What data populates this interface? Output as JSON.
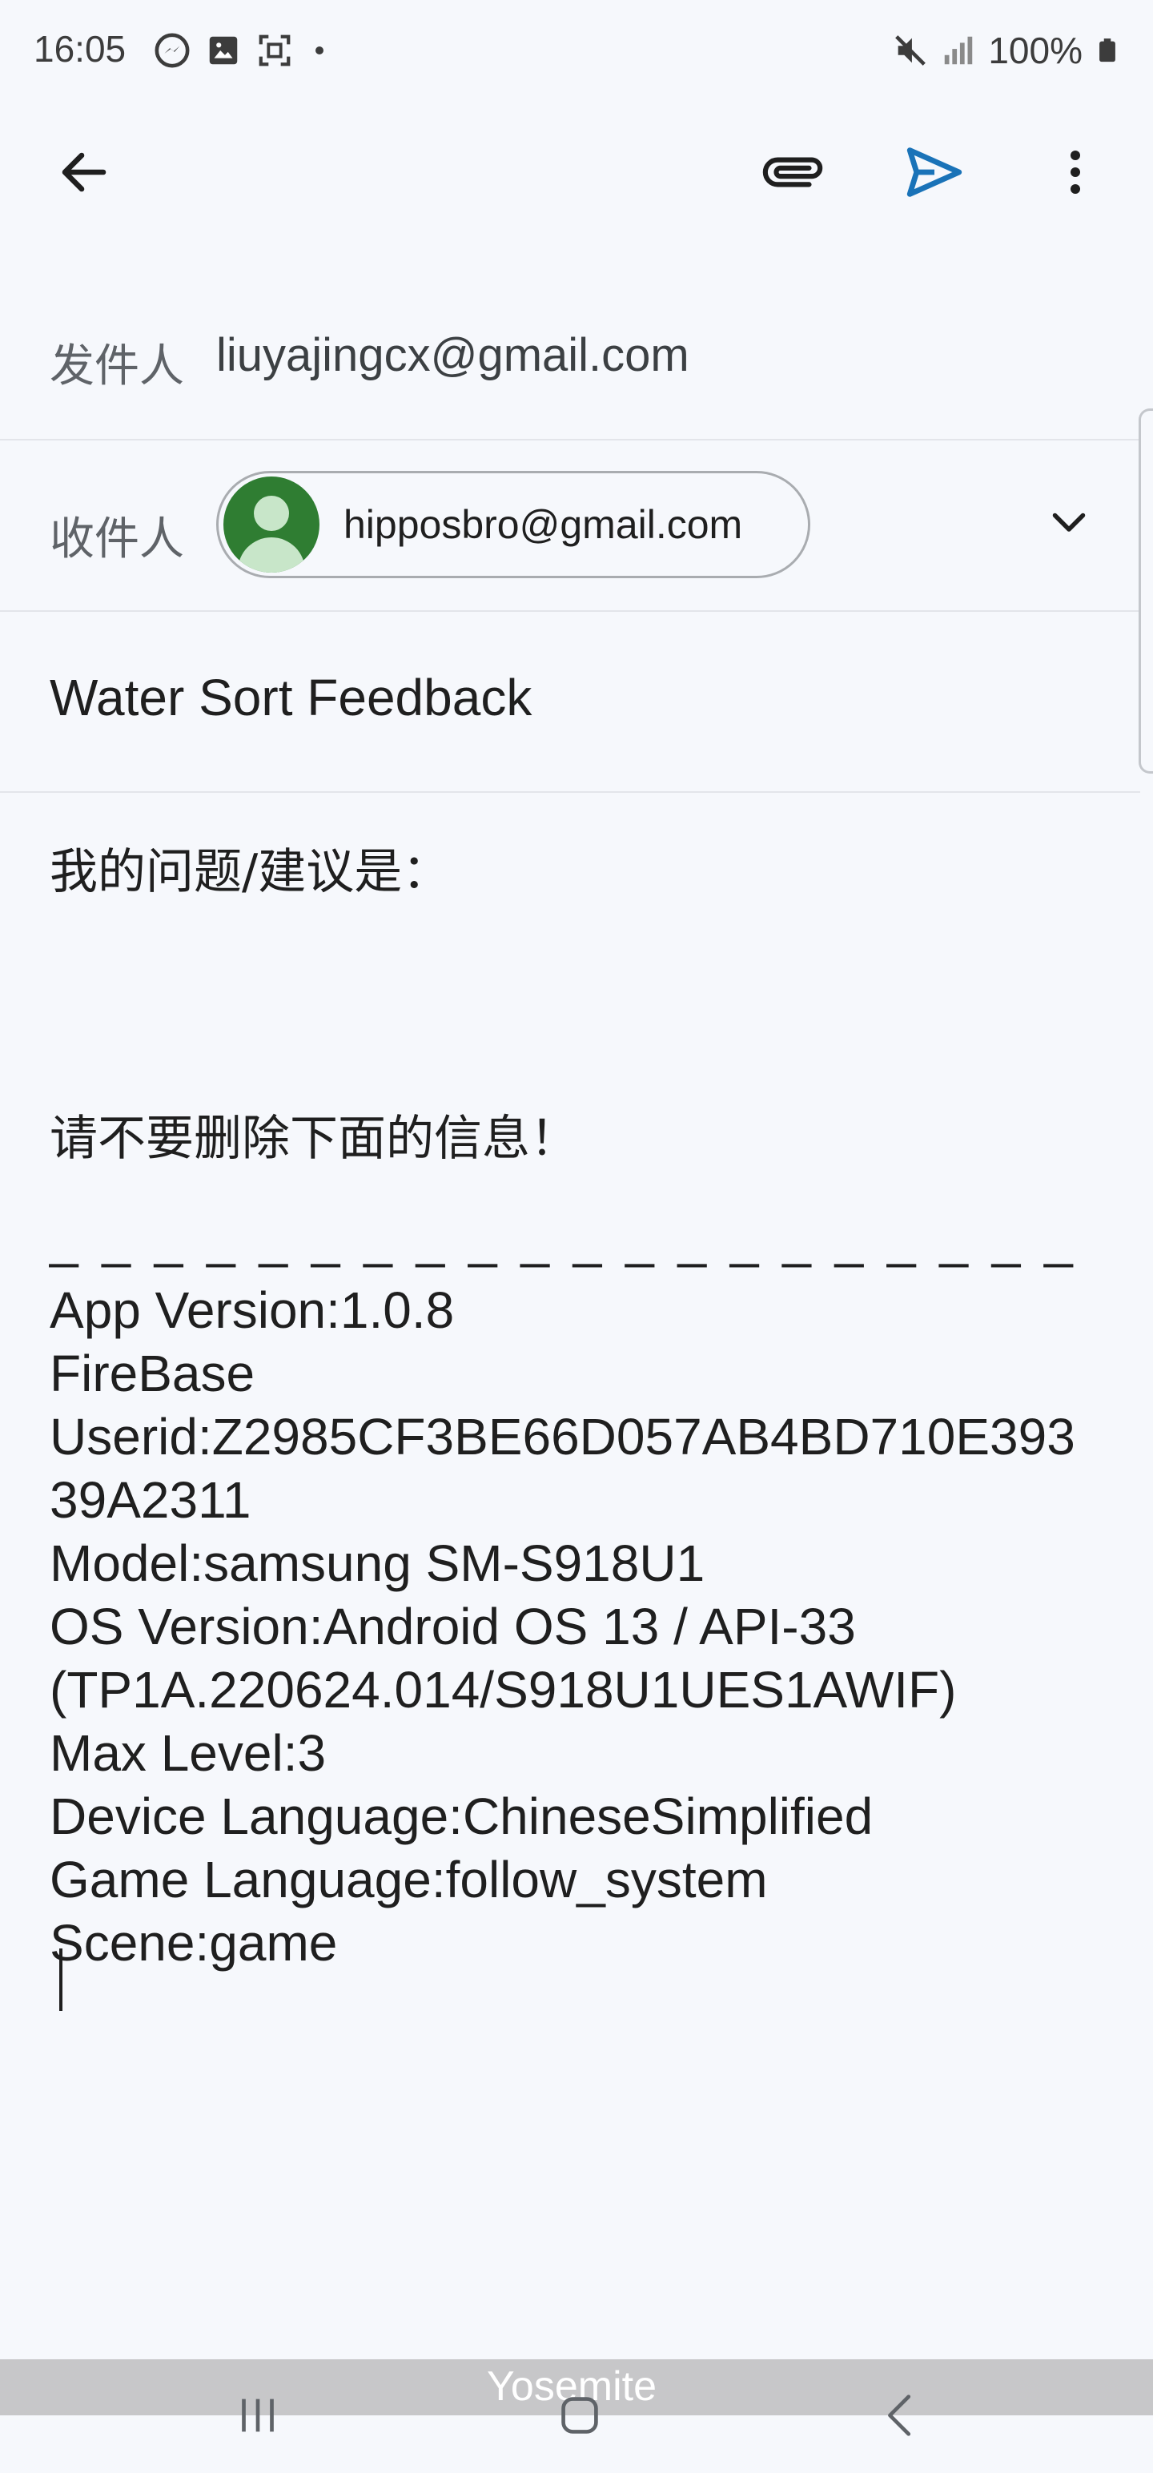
{
  "status_bar": {
    "time": "16:05",
    "battery": "100%",
    "left_icons": [
      "messenger-icon",
      "image-icon",
      "screenshot-icon",
      "dot-icon"
    ],
    "right_icons": [
      "mute-icon",
      "signal-icon",
      "battery-icon"
    ]
  },
  "toolbar": {
    "icons": [
      "back-arrow-icon",
      "attach-icon",
      "send-icon",
      "more-vert-icon"
    ],
    "send_color": "#1a73b8"
  },
  "compose": {
    "from_label": "发件人",
    "from_value": "liuyajingcx@gmail.com",
    "to_label": "收件人",
    "to_recipient": "hipposbro@gmail.com",
    "avatar_color": "#2f7d32",
    "subject": "Water Sort Feedback"
  },
  "body": {
    "prompt": "我的问题/建议是：",
    "warning": "请不要删除下面的信息！",
    "dashes": "_ _ _ _ _ _ _ _ _ _ _ _ _ _ _ _ _ _ _ _",
    "info_lines": [
      "App Version:1.0.8",
      "FireBase",
      "Userid:Z2985CF3BE66D057AB4BD710E393",
      "39A2311",
      "Model:samsung SM-S918U1",
      "OS Version:Android OS 13 / API-33",
      "(TP1A.220624.014/S918U1UES1AWIF)",
      "Max Level:3",
      "Device Language:ChineseSimplified",
      "Game Language:follow_system",
      "Scene:game"
    ]
  },
  "nav_bar": {
    "watermark": "Yosemite",
    "icons": [
      "recents-icon",
      "home-icon",
      "nav-back-icon"
    ]
  }
}
